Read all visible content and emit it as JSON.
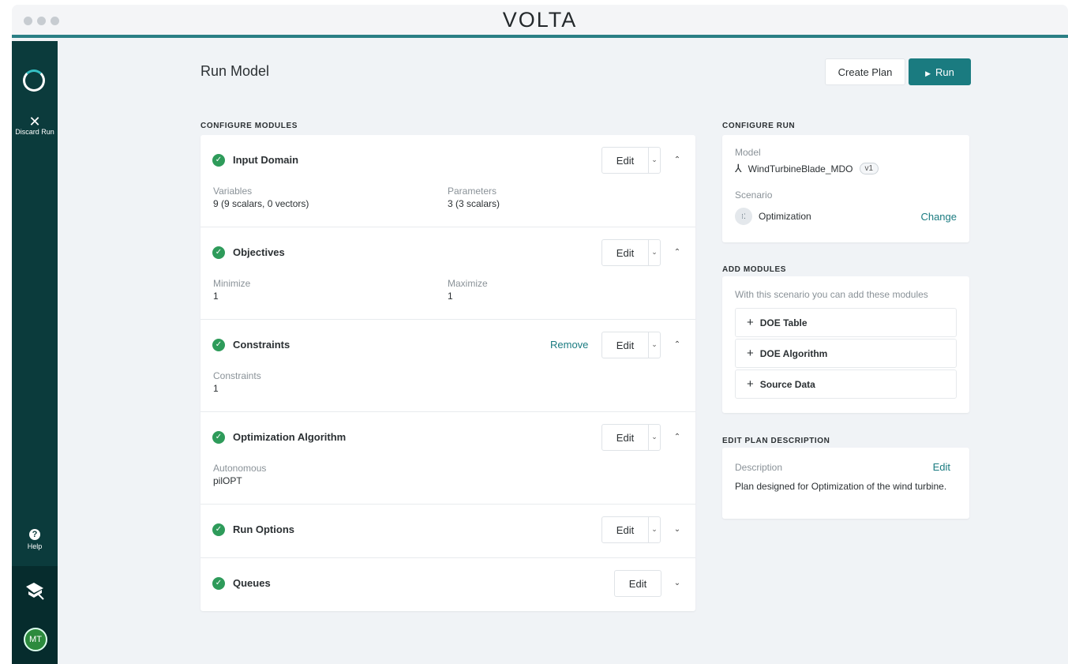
{
  "window": {
    "brand": "VOLTA"
  },
  "sidebar": {
    "discard_icon": "close-icon",
    "discard_label": "Discard Run",
    "help_label": "Help",
    "avatar_initials": "MT"
  },
  "header": {
    "title": "Run Model",
    "create_plan_label": "Create Plan",
    "run_label": "Run"
  },
  "configure_modules": {
    "label": "CONFIGURE MODULES",
    "edit_label": "Edit",
    "remove_label": "Remove",
    "modules": [
      {
        "title": "Input Domain",
        "expanded": true,
        "fields": [
          {
            "k": "Variables",
            "v": "9 (9 scalars, 0 vectors)"
          },
          {
            "k": "Parameters",
            "v": "3 (3 scalars)"
          }
        ]
      },
      {
        "title": "Objectives",
        "expanded": true,
        "fields": [
          {
            "k": "Minimize",
            "v": "1"
          },
          {
            "k": "Maximize",
            "v": "1"
          }
        ]
      },
      {
        "title": "Constraints",
        "expanded": true,
        "fields": [
          {
            "k": "Constraints",
            "v": "1"
          }
        ]
      },
      {
        "title": "Optimization Algorithm",
        "expanded": true,
        "fields": [
          {
            "k": "Autonomous",
            "v": "pilOPT"
          }
        ]
      },
      {
        "title": "Run Options",
        "expanded": false
      },
      {
        "title": "Queues",
        "expanded": false
      }
    ]
  },
  "configure_run": {
    "label": "CONFIGURE RUN",
    "model_label": "Model",
    "model_name": "WindTurbineBlade_MDO",
    "model_version": "v1",
    "scenario_label": "Scenario",
    "scenario_name": "Optimization",
    "change_label": "Change"
  },
  "add_modules": {
    "label": "ADD MODULES",
    "description": "With this scenario you can add these modules",
    "items": [
      "DOE Table",
      "DOE Algorithm",
      "Source Data"
    ]
  },
  "plan_description": {
    "label": "EDIT PLAN DESCRIPTION",
    "field_label": "Description",
    "edit_label": "Edit",
    "text": "Plan designed for Optimization of the wind turbine."
  },
  "colors": {
    "accent": "#1a7b80",
    "sidebar": "#0b3b3c",
    "success": "#2e9b5a"
  }
}
